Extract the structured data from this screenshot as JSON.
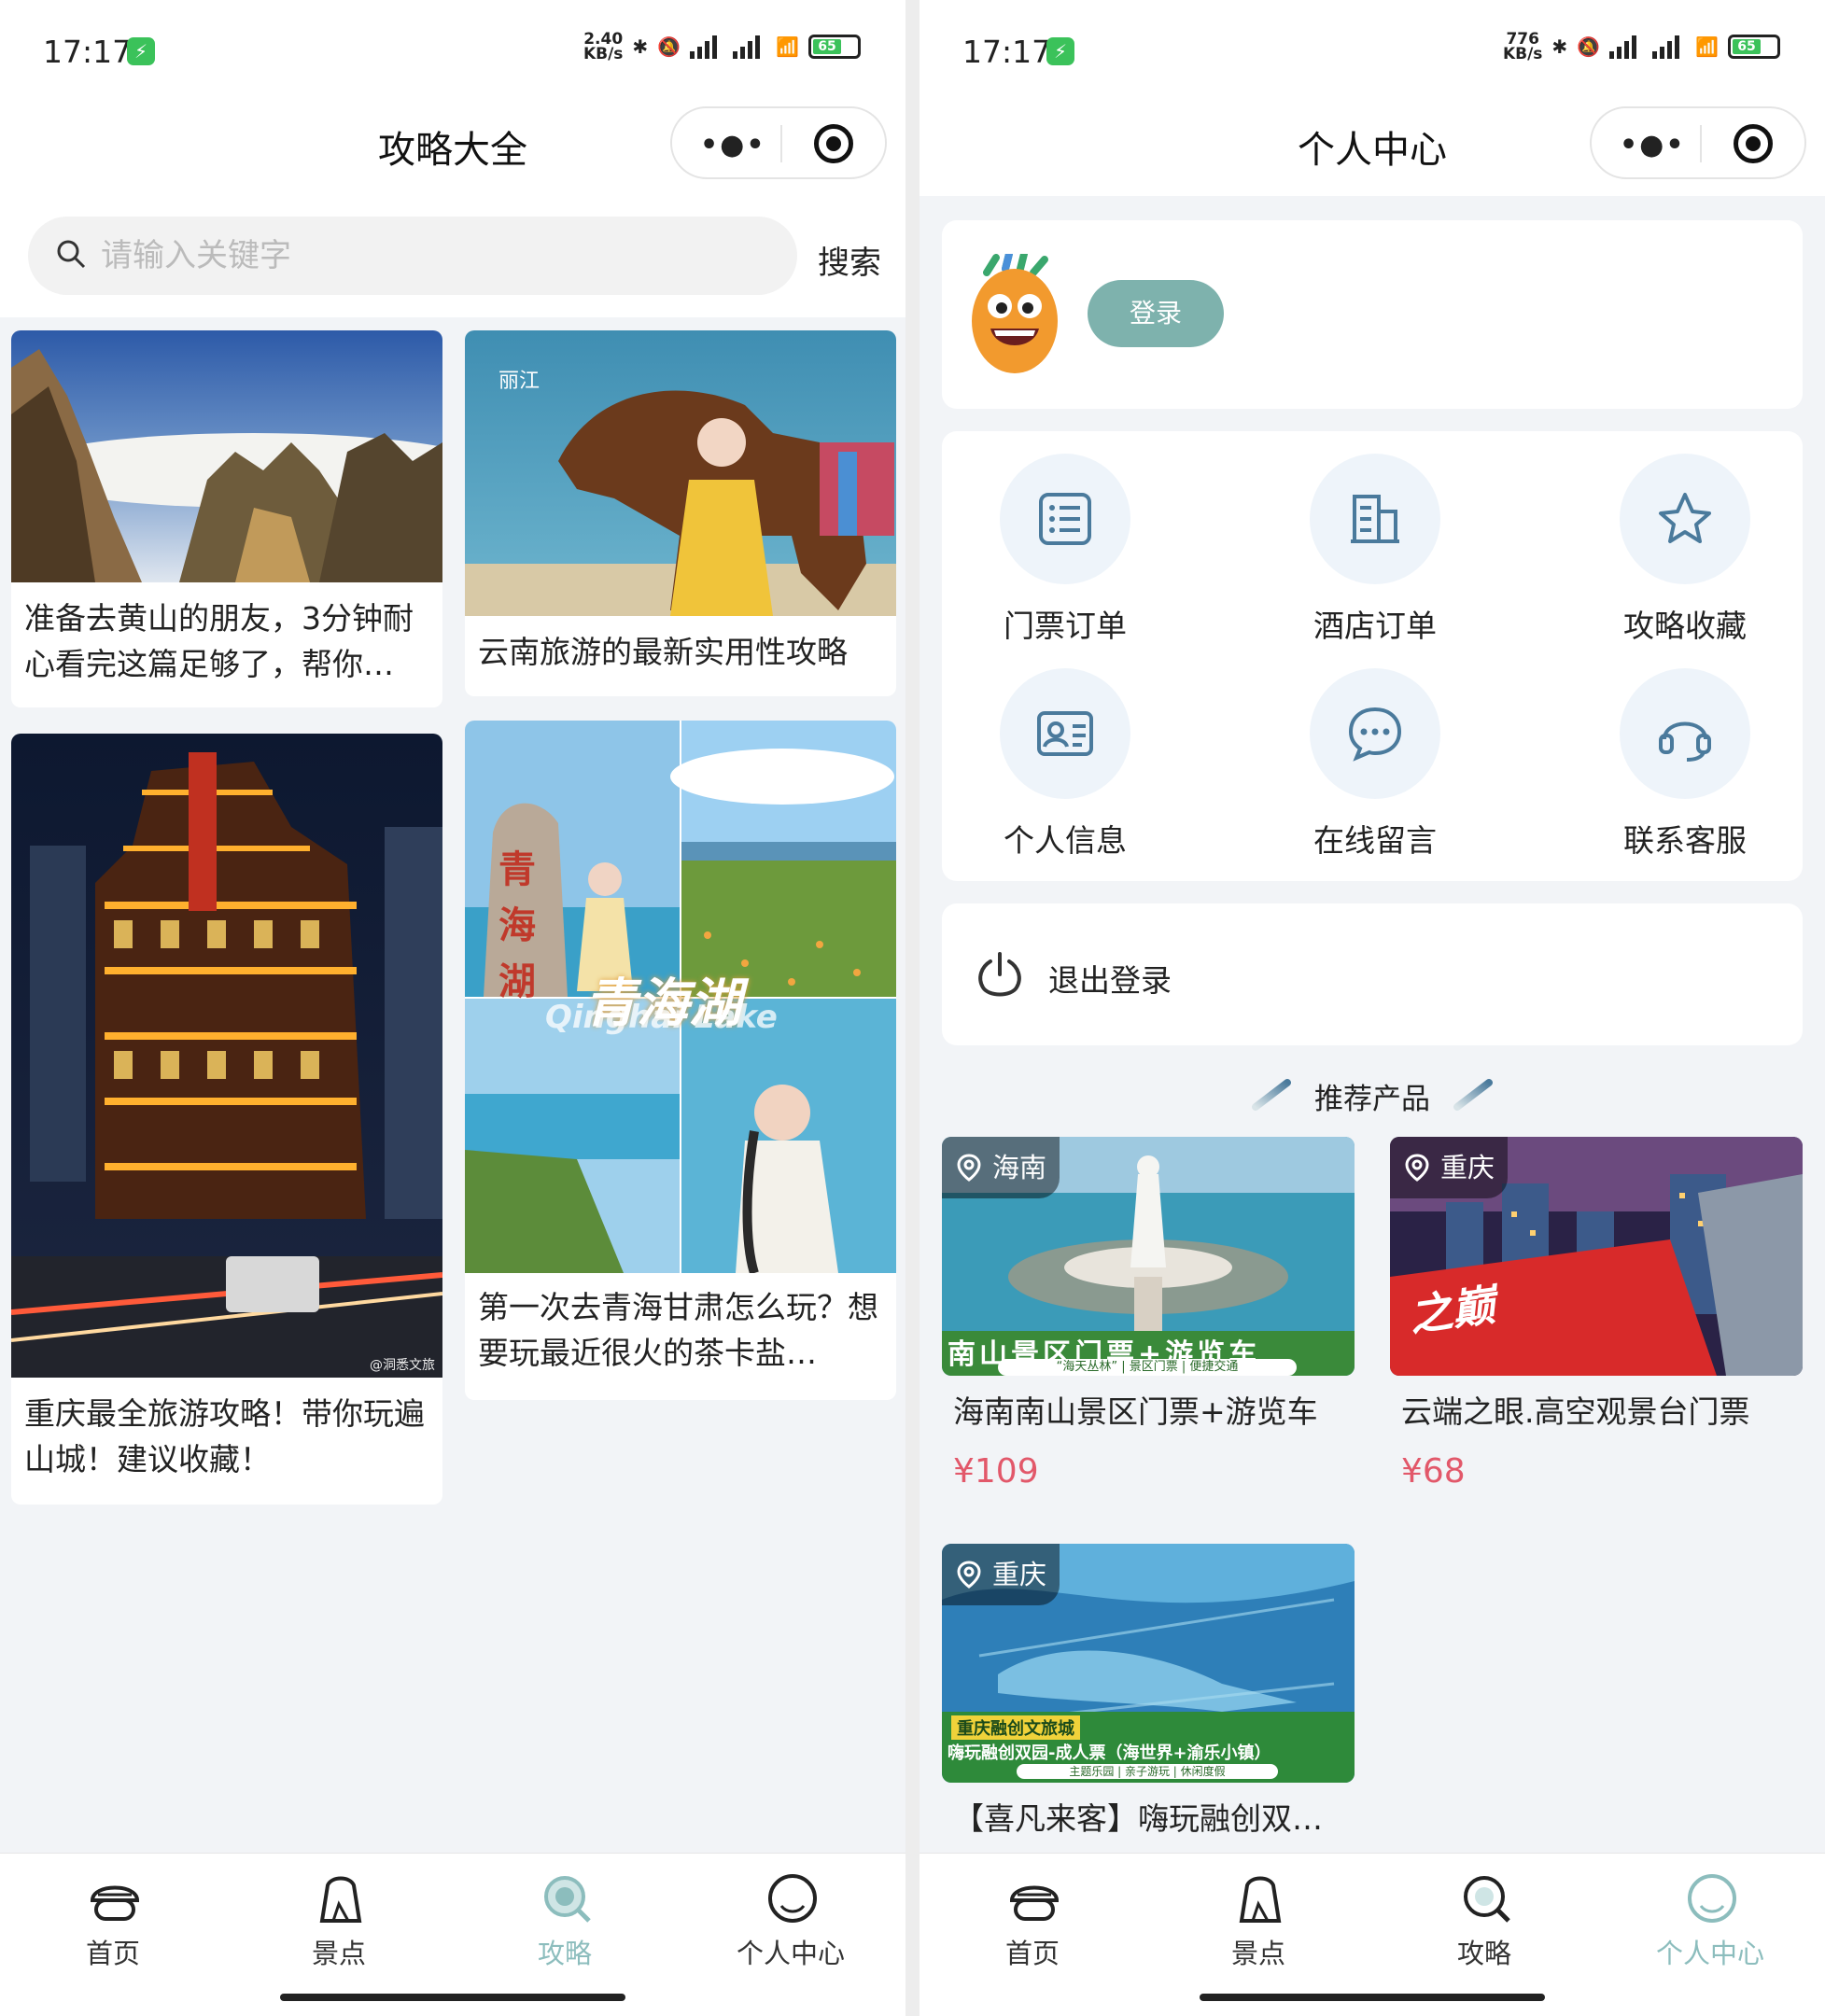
{
  "status_bar_left": {
    "time": "17:17",
    "net_speed_value": "2.40",
    "net_speed_unit": "KB/s",
    "battery": "65"
  },
  "status_bar_right": {
    "time": "17:17",
    "net_speed_value": "776",
    "net_speed_unit": "KB/s",
    "battery": "65"
  },
  "left_screen": {
    "title": "攻略大全",
    "search": {
      "placeholder": "请输入关键字",
      "button": "搜索"
    },
    "guides": [
      {
        "title": "准备去黄山的朋友，3分钟耐心看完这篇足够了，帮你…"
      },
      {
        "title": "云南旅游的最新实用性攻略",
        "image_caption": "丽江"
      },
      {
        "title": "重庆最全旅游攻略！带你玩遍山城！建议收藏！",
        "image_caption": "@洞悉文旅"
      },
      {
        "title": "第一次去青海甘肃怎么玩？想要玩最近很火的茶卡盐…",
        "image_caption": "青海湖",
        "image_caption_en": "Qinghai Lake",
        "image_stone_text": "青海湖"
      }
    ]
  },
  "right_screen": {
    "title": "个人中心",
    "login_button": "登录",
    "menu": [
      {
        "label": "门票订单",
        "icon": "ticket-list-icon"
      },
      {
        "label": "酒店订单",
        "icon": "hotel-building-icon"
      },
      {
        "label": "攻略收藏",
        "icon": "star-icon"
      },
      {
        "label": "个人信息",
        "icon": "id-card-icon"
      },
      {
        "label": "在线留言",
        "icon": "chat-bubble-icon"
      },
      {
        "label": "联系客服",
        "icon": "headset-icon"
      }
    ],
    "logout": "退出登录",
    "recommend_title": "推荐产品",
    "products": [
      {
        "location": "海南",
        "name": "海南南山景区门票+游览车",
        "price": "¥109",
        "banner": "南山景区门票+游览车",
        "banner_sub": "“海天丛林” | 景区门票 | 便捷交通"
      },
      {
        "location": "重庆",
        "name": "云端之眼.高空观景台门票",
        "price": "¥68",
        "banner": "之巅"
      },
      {
        "location": "重庆",
        "name": "【喜凡来客】嗨玩融创双…",
        "banner": "重庆融创文旅城",
        "banner_sub": "嗨玩融创双园-成人票（海世界+渝乐小镇）",
        "banner_sub2": "主题乐园 | 亲子游玩 | 休闲度假"
      }
    ]
  },
  "tabbar": [
    {
      "label": "首页",
      "icon": "home-icon"
    },
    {
      "label": "景点",
      "icon": "scenic-icon"
    },
    {
      "label": "攻略",
      "icon": "guide-search-icon"
    },
    {
      "label": "个人中心",
      "icon": "profile-icon"
    }
  ],
  "colors": {
    "accent": "#7eb2ad",
    "active_tab": "#8cbdbd",
    "price": "#e2586a",
    "icon_stroke": "#4a7a9c"
  }
}
